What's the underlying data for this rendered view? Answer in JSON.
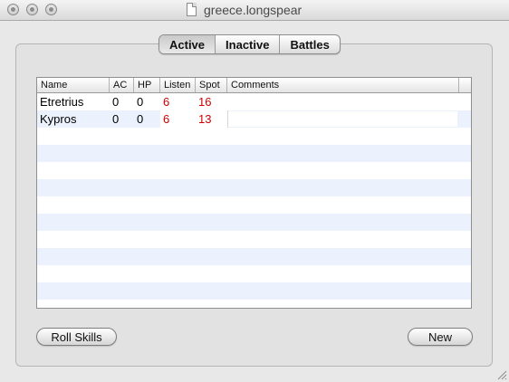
{
  "window": {
    "title": "greece.longspear"
  },
  "tabs": [
    {
      "label": "Active",
      "selected": true
    },
    {
      "label": "Inactive",
      "selected": false
    },
    {
      "label": "Battles",
      "selected": false
    }
  ],
  "table": {
    "columns": [
      "Name",
      "AC",
      "HP",
      "Listen",
      "Spot",
      "Comments"
    ],
    "rows": [
      {
        "name": "Etretrius",
        "ac": "0",
        "hp": "0",
        "listen": "6",
        "spot": "16",
        "comments": ""
      },
      {
        "name": "Kypros",
        "ac": "0",
        "hp": "0",
        "listen": "6",
        "spot": "13",
        "comments": ""
      }
    ]
  },
  "buttons": {
    "roll_skills": "Roll Skills",
    "new": "New"
  },
  "colors": {
    "stat_highlight": "#d00000",
    "row_stripe": "#ecf2fd"
  }
}
